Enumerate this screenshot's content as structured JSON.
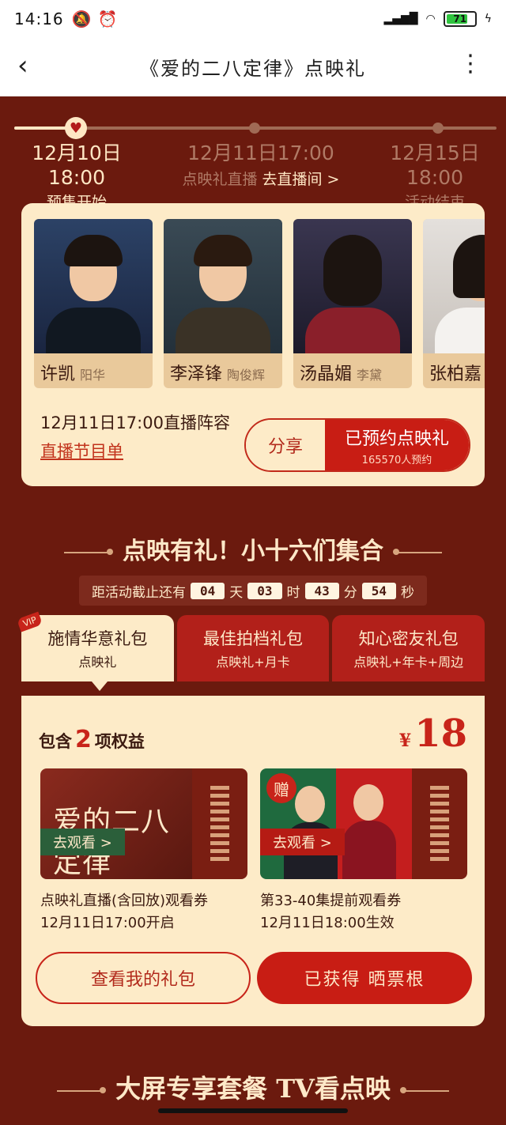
{
  "status_bar": {
    "time": "14:16",
    "battery": "71"
  },
  "nav": {
    "title": "《爱的二八定律》点映礼"
  },
  "timeline": [
    {
      "date": "12月10日18:00",
      "label": "预售开始"
    },
    {
      "date": "12月11日17:00",
      "label": "点映礼直播",
      "link": "去直播间 >"
    },
    {
      "date": "12月15日18:00",
      "label": "活动结束"
    }
  ],
  "cast": [
    {
      "actor": "许凯",
      "role": "阳华"
    },
    {
      "actor": "李泽锋",
      "role": "陶俊辉"
    },
    {
      "actor": "汤晶媚",
      "role": "李黛"
    },
    {
      "actor": "张柏嘉",
      "role": ""
    }
  ],
  "lineup": {
    "text": "12月11日17:00直播阵容",
    "schedule_link": "直播节目单"
  },
  "reserve": {
    "share": "分享",
    "reserved": "已预约点映礼",
    "count": "165570人预约"
  },
  "section1": {
    "title": "点映有礼！小十六们集合"
  },
  "countdown": {
    "prefix": "距活动截止还有",
    "days": "04",
    "days_unit": "天",
    "hours": "03",
    "hours_unit": "时",
    "minutes": "43",
    "minutes_unit": "分",
    "seconds": "54",
    "seconds_unit": "秒"
  },
  "tabs": [
    {
      "title": "施情华意礼包",
      "sub": "点映礼",
      "badge": "VIP"
    },
    {
      "title": "最佳拍档礼包",
      "sub": "点映礼+月卡"
    },
    {
      "title": "知心密友礼包",
      "sub": "点映礼+年卡+周边"
    }
  ],
  "package": {
    "benefit_prefix": "包含",
    "benefit_count": "2",
    "benefit_suffix": "项权益",
    "currency": "¥",
    "price": "18",
    "coupons": [
      {
        "poster_text": "爱的二八定律",
        "watch": "去观看 >",
        "desc1": "点映礼直播(含回放)观看券",
        "desc2": "12月11日17:00开启"
      },
      {
        "badge": "赠",
        "watch": "去观看 >",
        "desc1": "第33-40集提前观看券",
        "desc2": "12月11日18:00生效"
      }
    ],
    "my_gift_button": "查看我的礼包",
    "obtained_button": "已获得 晒票根"
  },
  "section2": {
    "title": "大屏专享套餐 TV看点映"
  },
  "colors": {
    "background": "#6b1a0e",
    "panel": "#fdebc8",
    "accent": "#c81d14",
    "cream": "#fde8c8"
  }
}
